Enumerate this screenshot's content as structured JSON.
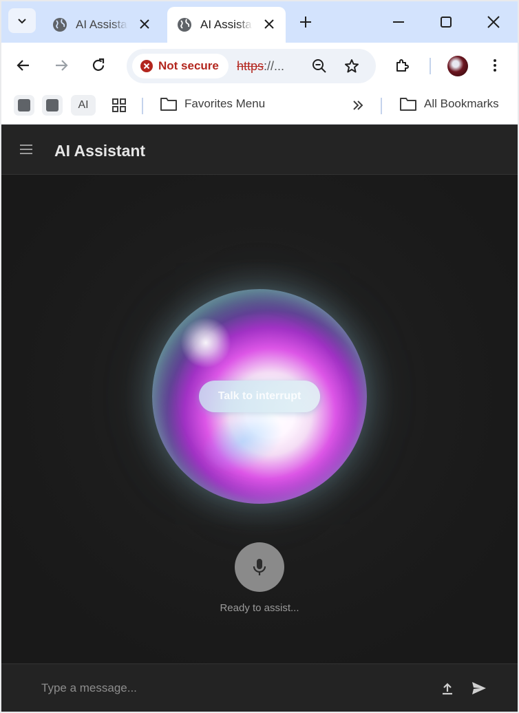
{
  "browser": {
    "tabs": [
      {
        "title": "AI Assistant",
        "active": false,
        "icon": "globe-icon"
      },
      {
        "title": "AI Assistant",
        "active": true,
        "icon": "globe-icon"
      }
    ],
    "address_bar": {
      "security_label": "Not secure",
      "url_scheme": "https",
      "url_rest": "://..."
    },
    "bookmarks": {
      "ai_label": "AI",
      "favorites_label": "Favorites Menu",
      "all_label": "All Bookmarks"
    }
  },
  "app": {
    "title": "AI Assistant",
    "interrupt_label": "Talk to interrupt",
    "status_text": "Ready to assist...",
    "message_placeholder": "Type a message..."
  },
  "colors": {
    "security_warning": "#b3261e",
    "tabstrip": "#d3e3fd",
    "app_background": "#1b1b1b"
  }
}
